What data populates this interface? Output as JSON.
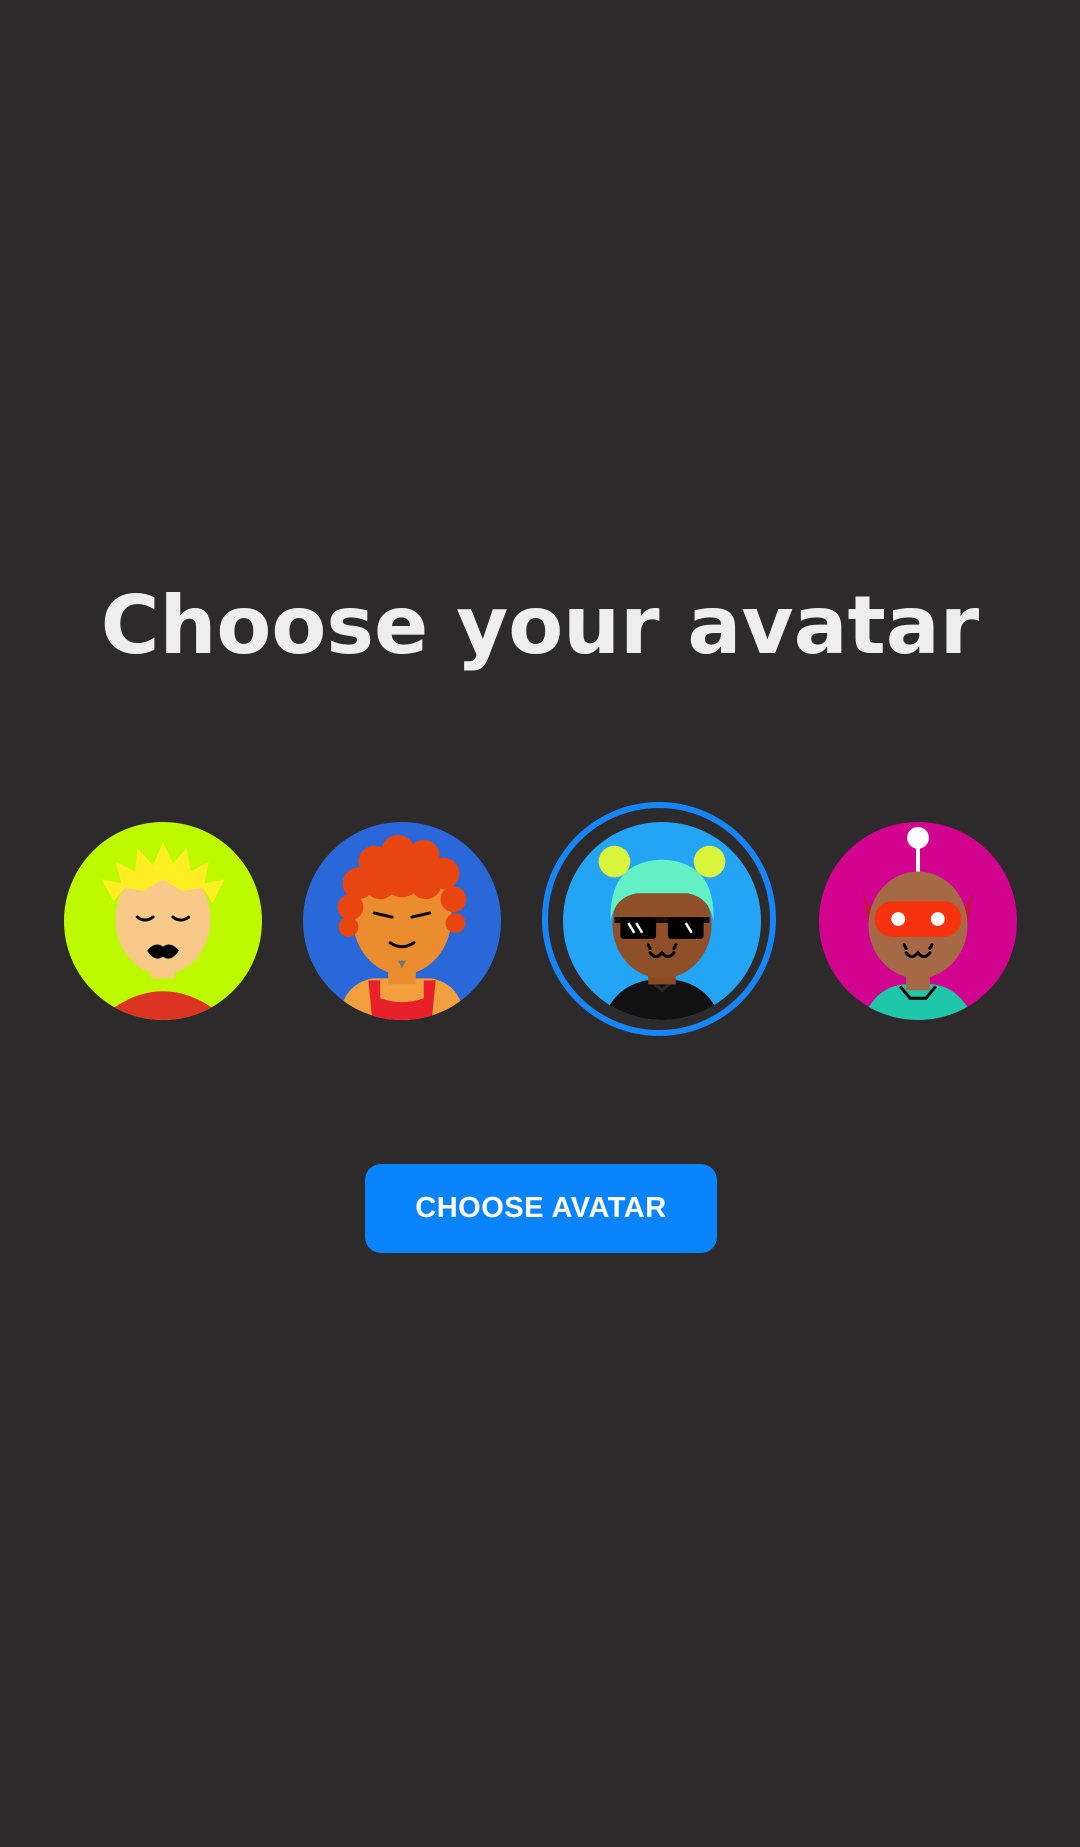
{
  "page": {
    "title": "Choose your avatar",
    "background_color": "#2c2a2b"
  },
  "avatars": {
    "selected_index": 2,
    "selection_color": "#1685f8",
    "items": [
      {
        "icon": "avatar-blonde-icon",
        "background": "#bdfa00"
      },
      {
        "icon": "avatar-curly-red-hair-icon",
        "background": "#2a68d9"
      },
      {
        "icon": "avatar-sunglasses-icon",
        "background": "#24a4f4"
      },
      {
        "icon": "avatar-robot-mask-icon",
        "background": "#d2038f"
      }
    ]
  },
  "actions": {
    "choose_button_label": "CHOOSE AVATAR",
    "button_color": "#0a84fd"
  }
}
